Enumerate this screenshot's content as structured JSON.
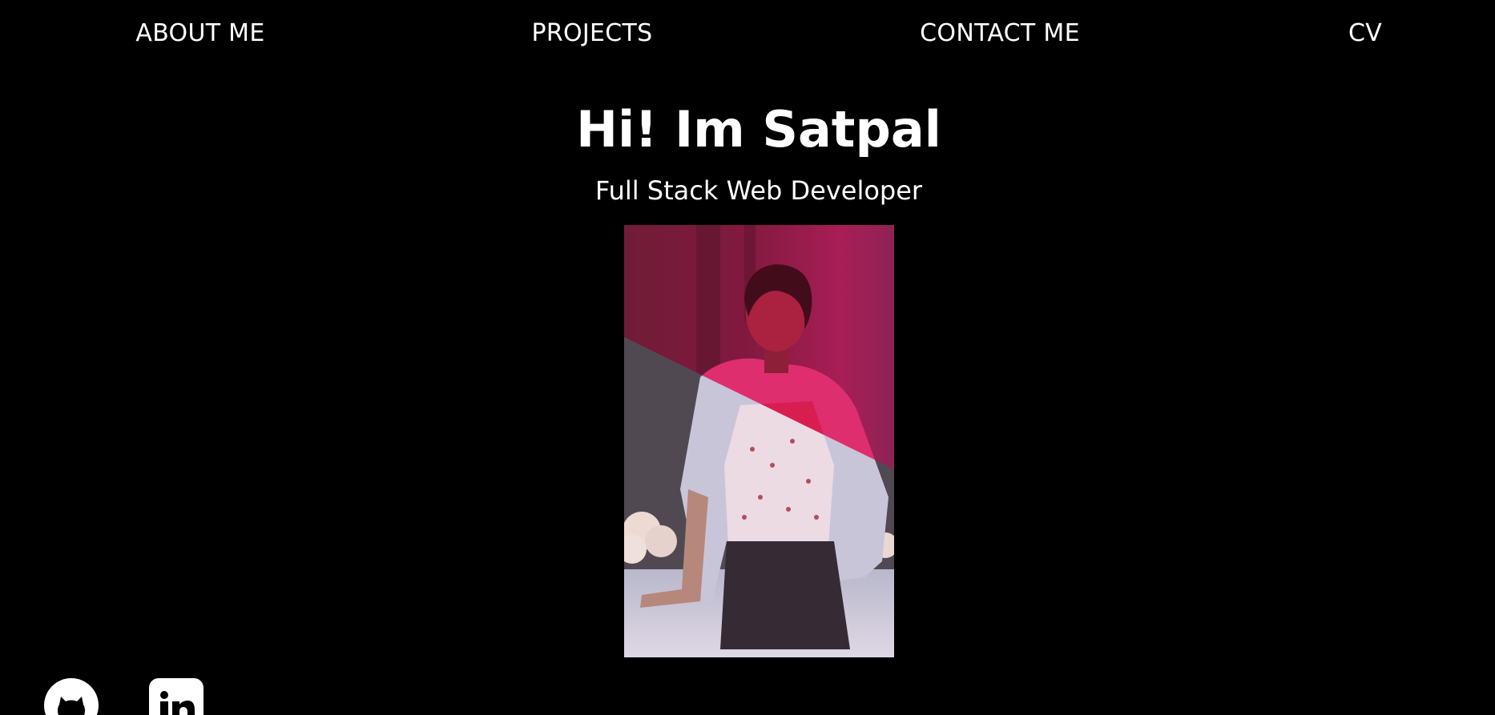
{
  "nav": {
    "items": [
      {
        "label": "ABOUT ME"
      },
      {
        "label": "PROJECTS"
      },
      {
        "label": "CONTACT ME"
      },
      {
        "label": "CV"
      }
    ]
  },
  "hero": {
    "title": "Hi! Im Satpal",
    "subtitle": "Full Stack Web Developer"
  },
  "portrait": {
    "icon": "portrait-photo",
    "overlay_color": "#e0186a"
  },
  "social": {
    "github_icon": "github-icon",
    "linkedin_icon": "linkedin-icon"
  },
  "colors": {
    "background": "#000000",
    "text": "#ffffff",
    "accent": "#e0186a"
  }
}
